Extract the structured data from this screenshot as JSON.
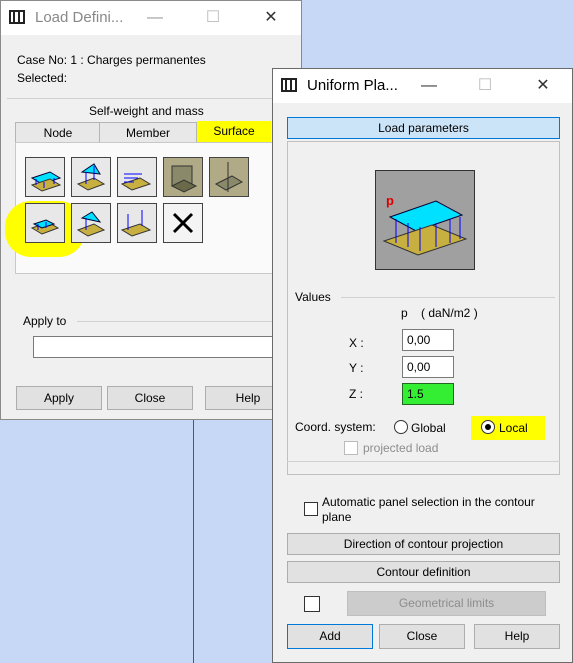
{
  "load_def": {
    "title": "Load Defini...",
    "case_line": "Case No: 1 : Charges permanentes",
    "selected_label": "Selected:",
    "section_label": "Self-weight and mass",
    "tabs": [
      "Node",
      "Member",
      "Surface"
    ],
    "apply_to_label": "Apply to",
    "apply_to_value": "",
    "buttons": {
      "apply": "Apply",
      "close": "Close",
      "help": "Help"
    }
  },
  "uniform": {
    "title": "Uniform Pla...",
    "load_params_button": "Load parameters",
    "diagram_label": "p",
    "values_label": "Values",
    "unit_label": "p    ( daN/m2 )",
    "x_label": "X :",
    "y_label": "Y :",
    "z_label": "Z :",
    "x_value": "0,00",
    "y_value": "0,00",
    "z_value": "1.5",
    "coord_label": "Coord. system:",
    "global_label": "Global",
    "local_label": "Local",
    "projected_label": "projected load",
    "auto_panel_label": "Automatic panel selection in the contour plane",
    "direction_button": "Direction of contour projection",
    "contour_button": "Contour definition",
    "geometrical_button": "Geometrical limits",
    "buttons": {
      "add": "Add",
      "close": "Close",
      "help": "Help"
    }
  },
  "window_controls": {
    "minimize": "—",
    "maximize": "☐",
    "close": "✕"
  },
  "colors": {
    "highlight": "#ffff00",
    "accent": "#0078d7",
    "z_field": "#33ee33"
  }
}
